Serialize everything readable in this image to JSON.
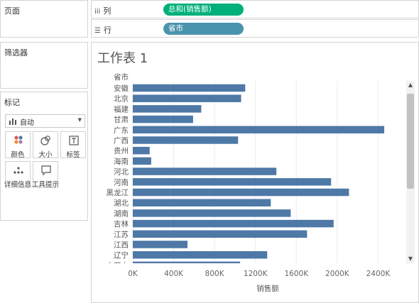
{
  "left_panels": {
    "pages_title": "页面",
    "filters_title": "筛选器",
    "marks_title": "标记",
    "mark_type": "自动",
    "mark_buttons": [
      {
        "label": "颜色",
        "icon": "color-icon"
      },
      {
        "label": "大小",
        "icon": "size-icon"
      },
      {
        "label": "标签",
        "icon": "label-icon"
      },
      {
        "label": "详细信息",
        "icon": "detail-icon"
      },
      {
        "label": "工具提示",
        "icon": "tooltip-icon"
      }
    ]
  },
  "shelves": {
    "columns_label": "列",
    "columns_pill": "总和(销售额)",
    "rows_label": "行",
    "rows_pill": "省市"
  },
  "sheet": {
    "title": "工作表 1"
  },
  "colors": {
    "bar": "#4e79a7",
    "columns_pill": "#00b07a",
    "rows_pill": "#4a93ad",
    "grid": "#ebebeb"
  },
  "chart_data": {
    "type": "bar",
    "orientation": "horizontal",
    "row_header": "省市",
    "xlabel": "销售额",
    "categories": [
      "安徽",
      "北京",
      "福建",
      "甘肃",
      "广东",
      "广西",
      "贵州",
      "海南",
      "河北",
      "河南",
      "黑龙江",
      "湖北",
      "湖南",
      "吉林",
      "江苏",
      "江西",
      "辽宁",
      "内蒙古"
    ],
    "values": [
      1100000,
      1060000,
      670000,
      590000,
      2460000,
      1030000,
      165000,
      180000,
      1405000,
      1940000,
      2115000,
      1350000,
      1545000,
      1965000,
      1705000,
      535000,
      1315000,
      1050000
    ],
    "x_ticks": [
      "0K",
      "400K",
      "800K",
      "1200K",
      "1600K",
      "2000K",
      "2400K"
    ],
    "x_tick_values": [
      0,
      400000,
      800000,
      1200000,
      1600000,
      2000000,
      2400000
    ],
    "xlim": [
      0,
      2550000
    ],
    "grid": true
  }
}
